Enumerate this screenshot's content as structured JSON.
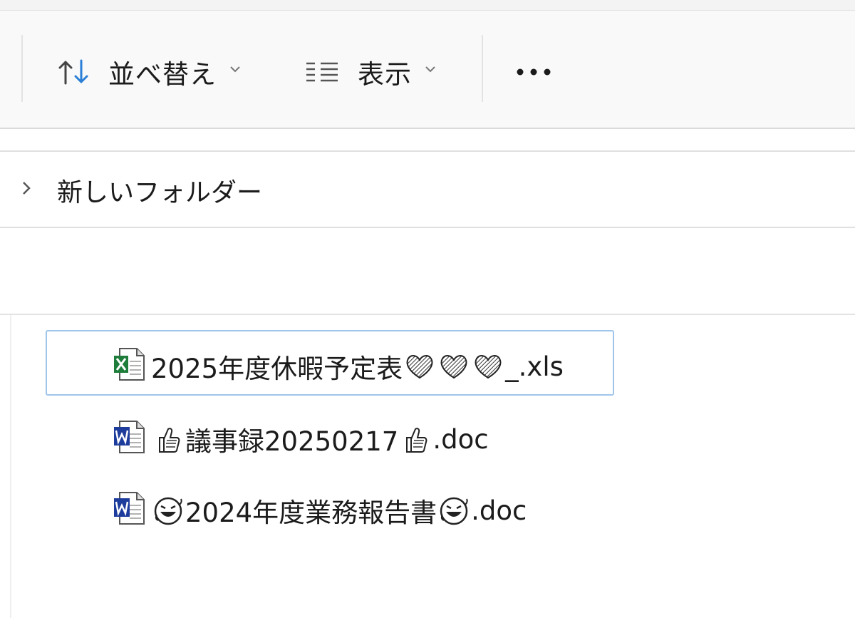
{
  "toolbar": {
    "sort_label": "並べ替え",
    "view_label": "表示",
    "more_label": "•••"
  },
  "nav": {
    "folder_label": "新しいフォルダー"
  },
  "files": [
    {
      "type": "excel",
      "name_prefix": "2025年度休暇予定表",
      "emoji": "heart",
      "name_suffix": "_.xls",
      "selected": true
    },
    {
      "type": "word",
      "name_prefix": "議事録20250217",
      "emoji": "thumbs",
      "name_suffix": ".doc",
      "selected": false
    },
    {
      "type": "word",
      "name_prefix": "2024年度業務報告書",
      "emoji": "laugh",
      "name_suffix": ".doc",
      "selected": false
    }
  ],
  "colors": {
    "selection_border": "#9fc6ea",
    "sort_arrow": "#2b7fd6",
    "excel_green": "#1e7d3a",
    "word_blue": "#1e3c9c"
  }
}
